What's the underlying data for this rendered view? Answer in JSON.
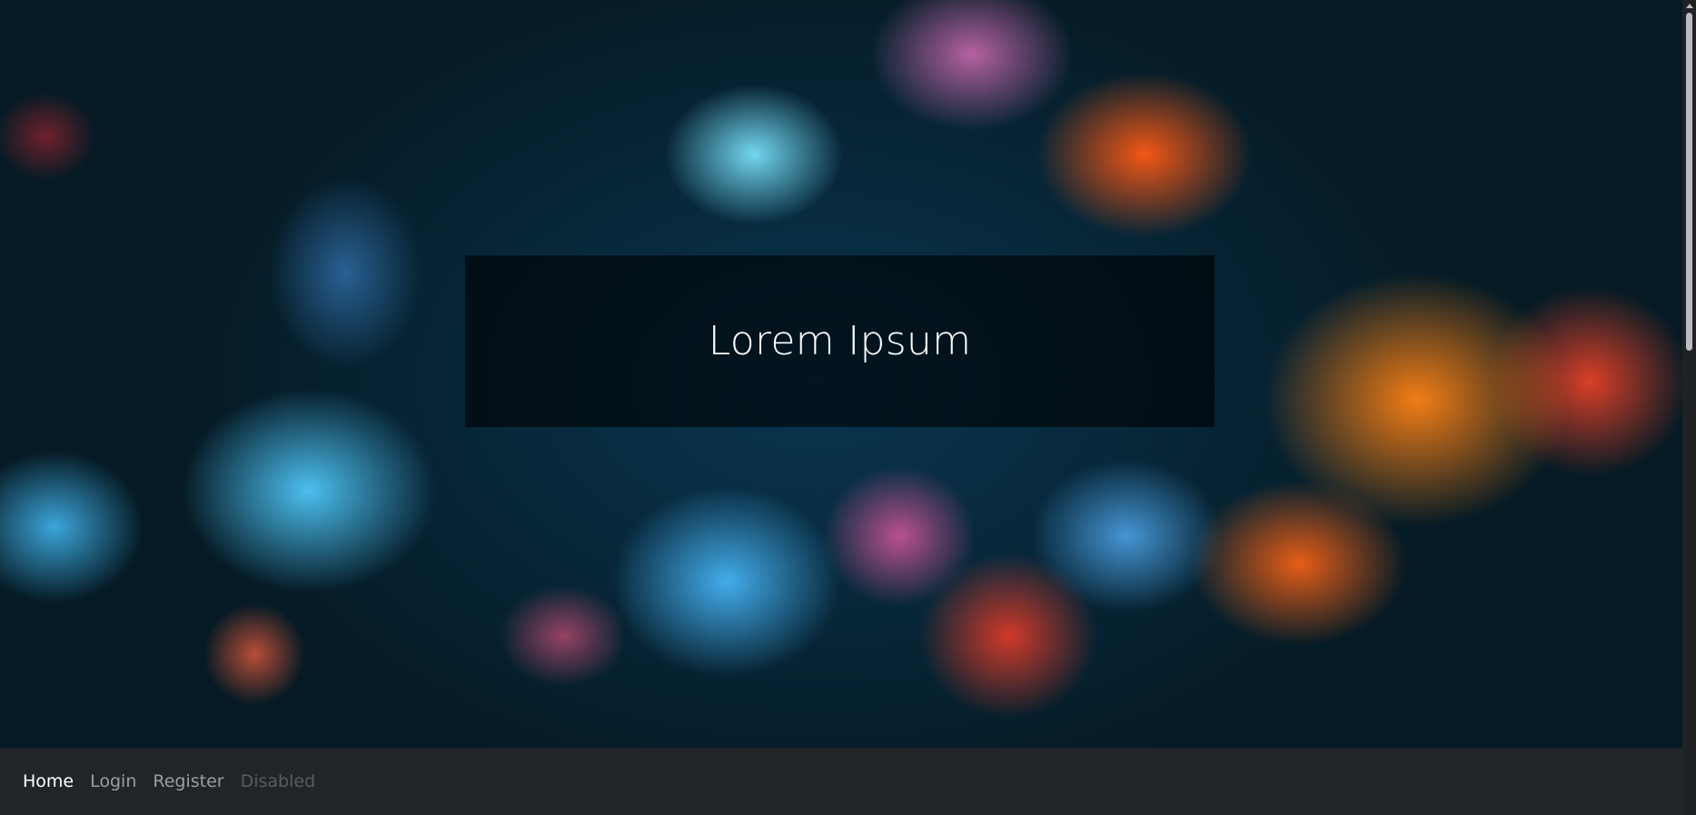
{
  "hero": {
    "title": "Lorem Ipsum"
  },
  "navbar": {
    "items": [
      {
        "label": "Home",
        "state": "active"
      },
      {
        "label": "Login",
        "state": "normal"
      },
      {
        "label": "Register",
        "state": "normal"
      },
      {
        "label": "Disabled",
        "state": "disabled"
      }
    ]
  },
  "colors": {
    "navbar_background": "#212529",
    "active_link": "#ffffff",
    "link": "rgba(255,255,255,0.55)",
    "disabled_link": "rgba(255,255,255,0.25)"
  }
}
